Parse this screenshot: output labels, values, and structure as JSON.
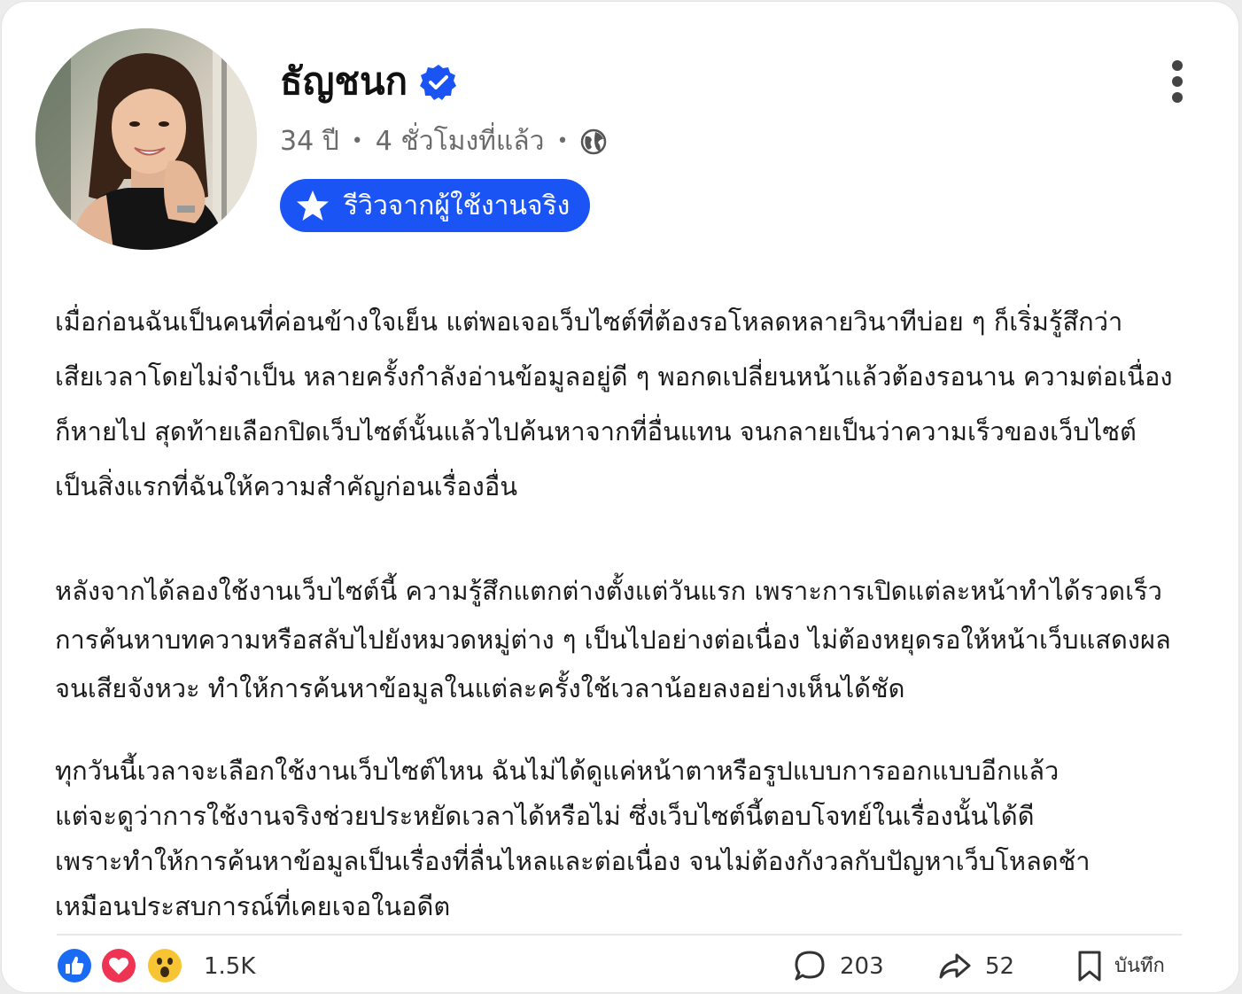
{
  "post": {
    "author": {
      "name": "ธัญชนก",
      "verified_icon": "verified-check-icon",
      "age": "34 ปี",
      "time": "4 ชั่วโมงที่แล้ว",
      "privacy_icon": "globe-icon"
    },
    "badge": {
      "label": "รีวิวจากผู้ใช้งานจริง",
      "icon": "star-icon",
      "color": "#1a54f4"
    },
    "paragraphs": [
      [
        "เมื่อก่อนฉันเป็นคนที่ค่อนข้างใจเย็น แต่พอเจอเว็บไซต์ที่ต้องรอโหลดหลายวินาทีบ่อย ๆ ก็เริ่มรู้สึกว่า",
        "เสียเวลาโดยไม่จำเป็น หลายครั้งกำลังอ่านข้อมูลอยู่ดี ๆ พอกดเปลี่ยนหน้าแล้วต้องรอนาน ความต่อเนื่อง",
        "ก็หายไป สุดท้ายเลือกปิดเว็บไซต์นั้นแล้วไปค้นหาจากที่อื่นแทน จนกลายเป็นว่าความเร็วของเว็บไซต์",
        "เป็นสิ่งแรกที่ฉันให้ความสำคัญก่อนเรื่องอื่น"
      ],
      [
        "หลังจากได้ลองใช้งานเว็บไซต์นี้ ความรู้สึกแตกต่างตั้งแต่วันแรก เพราะการเปิดแต่ละหน้าทำได้รวดเร็ว",
        "การค้นหาบทความหรือสลับไปยังหมวดหมู่ต่าง ๆ เป็นไปอย่างต่อเนื่อง ไม่ต้องหยุดรอให้หน้าเว็บแสดงผล",
        "จนเสียจังหวะ ทำให้การค้นหาข้อมูลในแต่ละครั้งใช้เวลาน้อยลงอย่างเห็นได้ชัด"
      ],
      [
        "ทุกวันนี้เวลาจะเลือกใช้งานเว็บไซต์ไหน ฉันไม่ได้ดูแค่หน้าตาหรือรูปแบบการออกแบบอีกแล้ว",
        "แต่จะดูว่าการใช้งานจริงช่วยประหยัดเวลาได้หรือไม่ ซึ่งเว็บไซต์นี้ตอบโจทย์ในเรื่องนั้นได้ดี",
        "เพราะทำให้การค้นหาข้อมูลเป็นเรื่องที่ลื่นไหลและต่อเนื่อง จนไม่ต้องกังวลกับปัญหาเว็บโหลดช้า",
        "เหมือนประสบการณ์ที่เคยเจอในอดีต"
      ]
    ],
    "reactions": {
      "icons": [
        "like-icon",
        "love-icon",
        "wow-icon"
      ],
      "count": "1.5K"
    },
    "actions": {
      "comment_icon": "comment-icon",
      "comments": "203",
      "share_icon": "share-icon",
      "shares": "52",
      "save_icon": "bookmark-icon",
      "save_label": "บันทึก"
    },
    "menu_icon": "more-vertical-icon"
  }
}
